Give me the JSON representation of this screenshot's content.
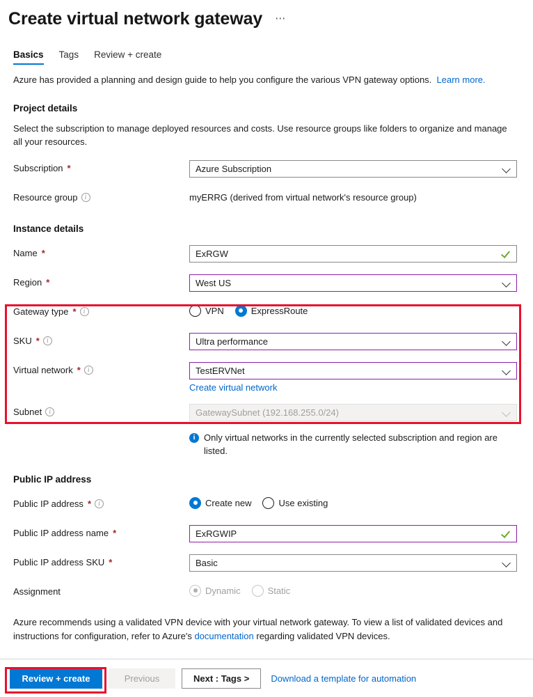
{
  "header": {
    "title": "Create virtual network gateway",
    "more_label": "⋯"
  },
  "tabs": [
    {
      "label": "Basics",
      "active": true
    },
    {
      "label": "Tags",
      "active": false
    },
    {
      "label": "Review + create",
      "active": false
    }
  ],
  "intro": {
    "text": "Azure has provided a planning and design guide to help you configure the various VPN gateway options.",
    "link_label": "Learn more."
  },
  "project_details": {
    "title": "Project details",
    "description": "Select the subscription to manage deployed resources and costs. Use resource groups like folders to organize and manage all your resources.",
    "subscription": {
      "label": "Subscription",
      "required": true,
      "value": "Azure Subscription",
      "icon": "chevron-down-icon"
    },
    "resource_group": {
      "label": "Resource group",
      "info_icon": "info-icon",
      "value": "myERRG (derived from virtual network's resource group)"
    }
  },
  "instance_details": {
    "title": "Instance details",
    "name": {
      "label": "Name",
      "required": true,
      "value": "ExRGW",
      "status_icon": "check-icon"
    },
    "region": {
      "label": "Region",
      "required": true,
      "value": "West US",
      "icon": "chevron-down-icon"
    },
    "gateway_type": {
      "label": "Gateway type",
      "required": true,
      "info_icon": "info-icon",
      "options": [
        {
          "label": "VPN",
          "selected": false
        },
        {
          "label": "ExpressRoute",
          "selected": true
        }
      ]
    },
    "sku": {
      "label": "SKU",
      "required": true,
      "info_icon": "info-icon",
      "value": "Ultra performance",
      "icon": "chevron-down-icon"
    },
    "virtual_network": {
      "label": "Virtual network",
      "required": true,
      "info_icon": "info-icon",
      "value": "TestERVNet",
      "icon": "chevron-down-icon",
      "create_link": "Create virtual network"
    },
    "subnet": {
      "label": "Subnet",
      "info_icon": "info-icon",
      "value": "GatewaySubnet (192.168.255.0/24)",
      "disabled": true,
      "icon": "chevron-down-icon"
    },
    "note": {
      "icon": "info-filled-icon",
      "text": "Only virtual networks in the currently selected subscription and region are listed."
    }
  },
  "public_ip": {
    "title": "Public IP address",
    "address": {
      "label": "Public IP address",
      "required": true,
      "info_icon": "info-icon",
      "options": [
        {
          "label": "Create new",
          "selected": true
        },
        {
          "label": "Use existing",
          "selected": false
        }
      ]
    },
    "address_name": {
      "label": "Public IP address name",
      "required": true,
      "value": "ExRGWIP",
      "status_icon": "check-icon"
    },
    "address_sku": {
      "label": "Public IP address SKU",
      "required": true,
      "value": "Basic",
      "icon": "chevron-down-icon"
    },
    "assignment": {
      "label": "Assignment",
      "disabled": true,
      "options": [
        {
          "label": "Dynamic",
          "selected": true
        },
        {
          "label": "Static",
          "selected": false
        }
      ]
    }
  },
  "footnote": {
    "text_before": "Azure recommends using a validated VPN device with your virtual network gateway. To view a list of validated devices and instructions for configuration, refer to Azure's",
    "link_label": "documentation",
    "text_after": "regarding validated VPN devices."
  },
  "footer": {
    "review_create": "Review + create",
    "previous": "Previous",
    "next": "Next : Tags >",
    "download_template": "Download a template for automation"
  },
  "colors": {
    "accent": "#0078d4",
    "highlight": "#e8112d",
    "focus_border": "#8c1ea8",
    "required": "#a4262c",
    "success": "#6aab2a",
    "link": "#0066cc"
  }
}
